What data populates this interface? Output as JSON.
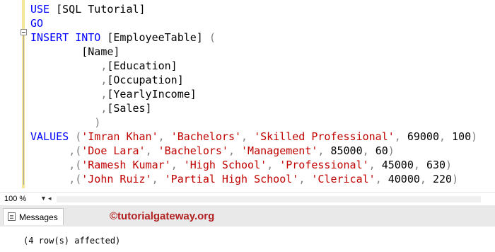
{
  "editor": {
    "lines": [
      {
        "parts": [
          {
            "t": "USE ",
            "c": "kw"
          },
          {
            "t": "[SQL Tutorial]",
            "c": ""
          }
        ]
      },
      {
        "parts": [
          {
            "t": "GO",
            "c": "kw"
          }
        ]
      },
      {
        "parts": [
          {
            "t": "INSERT INTO ",
            "c": "kw"
          },
          {
            "t": "[EmployeeTable] ",
            "c": ""
          },
          {
            "t": "(",
            "c": "gr"
          }
        ]
      },
      {
        "parts": [
          {
            "t": "        [Name]",
            "c": ""
          }
        ]
      },
      {
        "parts": [
          {
            "t": "           ",
            "c": ""
          },
          {
            "t": ",",
            "c": "gr"
          },
          {
            "t": "[Education]",
            "c": ""
          }
        ]
      },
      {
        "parts": [
          {
            "t": "           ",
            "c": ""
          },
          {
            "t": ",",
            "c": "gr"
          },
          {
            "t": "[Occupation]",
            "c": ""
          }
        ]
      },
      {
        "parts": [
          {
            "t": "           ",
            "c": ""
          },
          {
            "t": ",",
            "c": "gr"
          },
          {
            "t": "[YearlyIncome]",
            "c": ""
          }
        ]
      },
      {
        "parts": [
          {
            "t": "           ",
            "c": ""
          },
          {
            "t": ",",
            "c": "gr"
          },
          {
            "t": "[Sales]",
            "c": ""
          }
        ]
      },
      {
        "parts": [
          {
            "t": "          ",
            "c": ""
          },
          {
            "t": ")",
            "c": "gr"
          }
        ]
      },
      {
        "parts": [
          {
            "t": "VALUES ",
            "c": "kw"
          },
          {
            "t": "(",
            "c": "gr"
          },
          {
            "t": "'Imran Khan'",
            "c": "str"
          },
          {
            "t": ", ",
            "c": "gr"
          },
          {
            "t": "'Bachelors'",
            "c": "str"
          },
          {
            "t": ", ",
            "c": "gr"
          },
          {
            "t": "'Skilled Professional'",
            "c": "str"
          },
          {
            "t": ", ",
            "c": "gr"
          },
          {
            "t": "69000",
            "c": ""
          },
          {
            "t": ", ",
            "c": "gr"
          },
          {
            "t": "100",
            "c": ""
          },
          {
            "t": ")",
            "c": "gr"
          }
        ]
      },
      {
        "parts": [
          {
            "t": "      ",
            "c": ""
          },
          {
            "t": ",(",
            "c": "gr"
          },
          {
            "t": "'Doe Lara'",
            "c": "str"
          },
          {
            "t": ", ",
            "c": "gr"
          },
          {
            "t": "'Bachelors'",
            "c": "str"
          },
          {
            "t": ", ",
            "c": "gr"
          },
          {
            "t": "'Management'",
            "c": "str"
          },
          {
            "t": ", ",
            "c": "gr"
          },
          {
            "t": "85000",
            "c": ""
          },
          {
            "t": ", ",
            "c": "gr"
          },
          {
            "t": "60",
            "c": ""
          },
          {
            "t": ")",
            "c": "gr"
          }
        ]
      },
      {
        "parts": [
          {
            "t": "      ",
            "c": ""
          },
          {
            "t": ",(",
            "c": "gr"
          },
          {
            "t": "'Ramesh Kumar'",
            "c": "str"
          },
          {
            "t": ", ",
            "c": "gr"
          },
          {
            "t": "'High School'",
            "c": "str"
          },
          {
            "t": ", ",
            "c": "gr"
          },
          {
            "t": "'Professional'",
            "c": "str"
          },
          {
            "t": ", ",
            "c": "gr"
          },
          {
            "t": "45000",
            "c": ""
          },
          {
            "t": ", ",
            "c": "gr"
          },
          {
            "t": "630",
            "c": ""
          },
          {
            "t": ")",
            "c": "gr"
          }
        ]
      },
      {
        "parts": [
          {
            "t": "      ",
            "c": ""
          },
          {
            "t": ",(",
            "c": "gr"
          },
          {
            "t": "'John Ruiz'",
            "c": "str"
          },
          {
            "t": ", ",
            "c": "gr"
          },
          {
            "t": "'Partial High School'",
            "c": "str"
          },
          {
            "t": ", ",
            "c": "gr"
          },
          {
            "t": "'Clerical'",
            "c": "str"
          },
          {
            "t": ", ",
            "c": "gr"
          },
          {
            "t": "40000",
            "c": ""
          },
          {
            "t": ", ",
            "c": "gr"
          },
          {
            "t": "220",
            "c": ""
          },
          {
            "t": ")",
            "c": "gr"
          }
        ]
      }
    ]
  },
  "statusbar": {
    "zoom": "100 %",
    "zoom_arrow_icon": "chevron-down-icon"
  },
  "results": {
    "tab_label": "Messages",
    "tab_icon": "messages-icon",
    "watermark": "©tutorialgateway.org",
    "message": "(4 row(s) affected)"
  },
  "colors": {
    "keyword": "#0000ff",
    "string": "#c00000",
    "punctuation": "#808080",
    "watermark": "#b22222"
  }
}
